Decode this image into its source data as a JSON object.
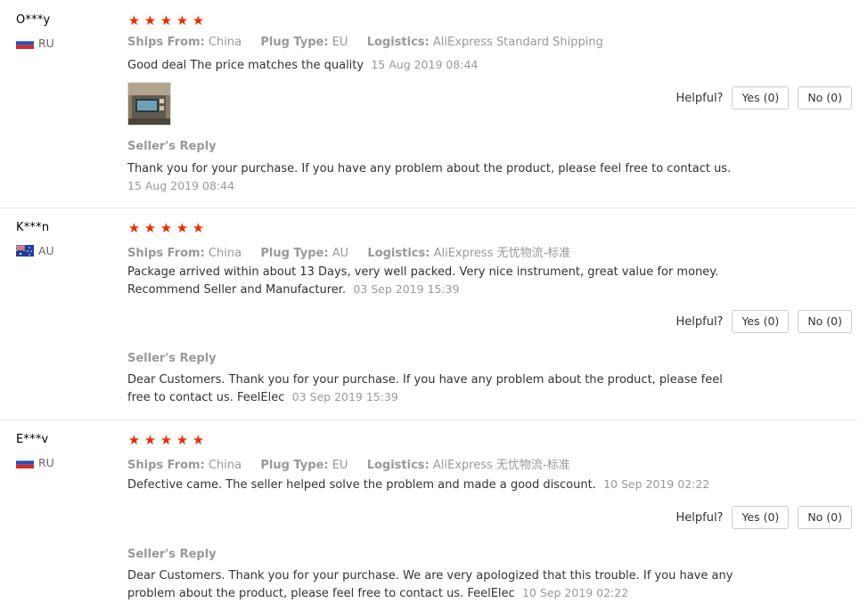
{
  "colors": {
    "star": "#e62e04",
    "muted": "#999999",
    "text": "#333333",
    "border": "#e8e8e8"
  },
  "icons": {
    "star": "star-icon",
    "flag_ru": "russia-flag-icon",
    "flag_au": "australia-flag-icon",
    "photo": "review-photo-thumbnail"
  },
  "reviews": [
    {
      "user": "O***y",
      "country": "RU",
      "rating": 5,
      "ships_from_label": "Ships From:",
      "ships_from": "China",
      "plug_label": "Plug Type:",
      "plug": "EU",
      "logistics_label": "Logistics:",
      "logistics": "AliExpress Standard Shipping",
      "text": "Good deal The price matches the quality",
      "date": "15 Aug 2019 08:44",
      "helpful_label": "Helpful?",
      "yes_label": "Yes (0)",
      "no_label": "No (0)",
      "reply_label": "Seller's Reply",
      "reply_text": "Thank you for your purchase. If you have any problem about the product, please feel free to contact us.",
      "reply_date": "15 Aug 2019 08:44"
    },
    {
      "user": "K***n",
      "country": "AU",
      "rating": 5,
      "ships_from_label": "Ships From:",
      "ships_from": "China",
      "plug_label": "Plug Type:",
      "plug": "AU",
      "logistics_label": "Logistics:",
      "logistics": "AliExpress 无忧物流-标准",
      "text": "Package arrived within about 13 Days, very well packed. Very nice instrument, great value for money. Recommend Seller and Manufacturer.",
      "date": "03 Sep 2019 15:39",
      "helpful_label": "Helpful?",
      "yes_label": "Yes (0)",
      "no_label": "No (0)",
      "reply_label": "Seller's Reply",
      "reply_text": "Dear Customers. Thank you for your purchase. If you have any problem about the product, please feel free to contact us. FeelElec",
      "reply_date": "03 Sep 2019 15:39"
    },
    {
      "user": "E***v",
      "country": "RU",
      "rating": 5,
      "ships_from_label": "Ships From:",
      "ships_from": "China",
      "plug_label": "Plug Type:",
      "plug": "EU",
      "logistics_label": "Logistics:",
      "logistics": "AliExpress 无忧物流-标准",
      "text": "Defective came. The seller helped solve the problem and made a good discount.",
      "date": "10 Sep 2019 02:22",
      "helpful_label": "Helpful?",
      "yes_label": "Yes (0)",
      "no_label": "No (0)",
      "reply_label": "Seller's Reply",
      "reply_text": "Dear Customers. Thank you for your purchase. We are very apologized that this trouble. If you have any problem about the product, please feel free to contact us. FeelElec",
      "reply_date": "10 Sep 2019 02:22"
    }
  ]
}
